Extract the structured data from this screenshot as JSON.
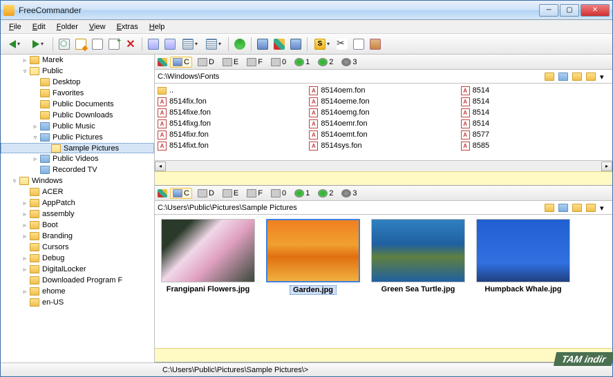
{
  "window": {
    "title": "FreeCommander"
  },
  "menu": [
    "File",
    "Edit",
    "Folder",
    "View",
    "Extras",
    "Help"
  ],
  "tree": [
    {
      "indent": 2,
      "expander": "▹",
      "label": "Marek",
      "iconClass": ""
    },
    {
      "indent": 2,
      "expander": "▿",
      "label": "Public",
      "iconClass": "open"
    },
    {
      "indent": 3,
      "expander": "",
      "label": "Desktop",
      "iconClass": ""
    },
    {
      "indent": 3,
      "expander": "",
      "label": "Favorites",
      "iconClass": ""
    },
    {
      "indent": 3,
      "expander": "",
      "label": "Public Documents",
      "iconClass": ""
    },
    {
      "indent": 3,
      "expander": "",
      "label": "Public Downloads",
      "iconClass": ""
    },
    {
      "indent": 3,
      "expander": "▹",
      "label": "Public Music",
      "iconClass": "sp"
    },
    {
      "indent": 3,
      "expander": "▿",
      "label": "Public Pictures",
      "iconClass": "sp"
    },
    {
      "indent": 4,
      "expander": "",
      "label": "Sample Pictures",
      "iconClass": "open",
      "selected": true
    },
    {
      "indent": 3,
      "expander": "▹",
      "label": "Public Videos",
      "iconClass": "sp"
    },
    {
      "indent": 3,
      "expander": "",
      "label": "Recorded TV",
      "iconClass": "sp"
    },
    {
      "indent": 1,
      "expander": "▿",
      "label": "Windows",
      "iconClass": "open"
    },
    {
      "indent": 2,
      "expander": "",
      "label": "ACER",
      "iconClass": ""
    },
    {
      "indent": 2,
      "expander": "▹",
      "label": "AppPatch",
      "iconClass": ""
    },
    {
      "indent": 2,
      "expander": "▹",
      "label": "assembly",
      "iconClass": ""
    },
    {
      "indent": 2,
      "expander": "▹",
      "label": "Boot",
      "iconClass": ""
    },
    {
      "indent": 2,
      "expander": "▹",
      "label": "Branding",
      "iconClass": ""
    },
    {
      "indent": 2,
      "expander": "",
      "label": "Cursors",
      "iconClass": ""
    },
    {
      "indent": 2,
      "expander": "▹",
      "label": "Debug",
      "iconClass": ""
    },
    {
      "indent": 2,
      "expander": "▹",
      "label": "DigitalLocker",
      "iconClass": ""
    },
    {
      "indent": 2,
      "expander": "",
      "label": "Downloaded Program F",
      "iconClass": ""
    },
    {
      "indent": 2,
      "expander": "▹",
      "label": "ehome",
      "iconClass": ""
    },
    {
      "indent": 2,
      "expander": "",
      "label": "en-US",
      "iconClass": ""
    }
  ],
  "drives": [
    {
      "icon": "c",
      "letter": "C",
      "selBottom": true
    },
    {
      "icon": "",
      "letter": "D"
    },
    {
      "icon": "",
      "letter": "E"
    },
    {
      "icon": "",
      "letter": "F"
    },
    {
      "icon": "",
      "letter": "0"
    },
    {
      "icon": "net",
      "letter": "1"
    },
    {
      "icon": "net",
      "letter": "2"
    },
    {
      "icon": "gear",
      "letter": "3"
    }
  ],
  "top_pane": {
    "path": "C:\\Windows\\Fonts",
    "cols": [
      [
        "..",
        "8514fix.fon",
        "8514fixe.fon",
        "8514fixg.fon",
        "8514fixr.fon",
        "8514fixt.fon"
      ],
      [
        "8514oem.fon",
        "8514oeme.fon",
        "8514oemg.fon",
        "8514oemr.fon",
        "8514oemt.fon",
        "8514sys.fon"
      ],
      [
        "8514",
        "8514",
        "8514",
        "8514",
        "8577",
        "8585"
      ]
    ]
  },
  "bottom_pane": {
    "path": "C:\\Users\\Public\\Pictures\\Sample Pictures",
    "thumbs": [
      {
        "label": "Frangipani Flowers.jpg",
        "imgClass": "img-flowers"
      },
      {
        "label": "Garden.jpg",
        "imgClass": "img-garden",
        "selected": true
      },
      {
        "label": "Green Sea Turtle.jpg",
        "imgClass": "img-turtle"
      },
      {
        "label": "Humpback Whale.jpg",
        "imgClass": "img-whale"
      }
    ]
  },
  "status": "C:\\Users\\Public\\Pictures\\Sample Pictures\\>",
  "watermark": "TAM indir"
}
